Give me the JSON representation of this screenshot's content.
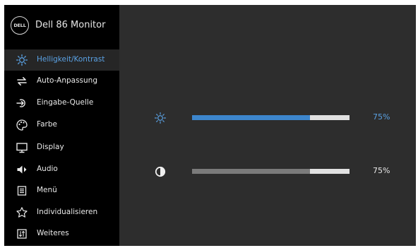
{
  "brand": {
    "logo_text": "DELL",
    "model": "Dell 86 Monitor"
  },
  "menu": [
    {
      "icon": "brightness-icon",
      "label": "Helligkeit/Kontrast",
      "active": true
    },
    {
      "icon": "auto-adjust-icon",
      "label": "Auto-Anpassung",
      "active": false
    },
    {
      "icon": "input-source-icon",
      "label": "Eingabe-Quelle",
      "active": false
    },
    {
      "icon": "palette-icon",
      "label": "Farbe",
      "active": false
    },
    {
      "icon": "display-icon",
      "label": "Display",
      "active": false
    },
    {
      "icon": "audio-icon",
      "label": "Audio",
      "active": false
    },
    {
      "icon": "menu-icon",
      "label": "Menü",
      "active": false
    },
    {
      "icon": "star-icon",
      "label": "Individualisieren",
      "active": false
    },
    {
      "icon": "others-icon",
      "label": "Weiteres",
      "active": false
    }
  ],
  "controls": {
    "brightness": {
      "icon": "brightness-icon",
      "value": 75,
      "display": "75%",
      "fill_color": "#3d86cc",
      "text_color": "#5aa1e3",
      "selected": true
    },
    "contrast": {
      "icon": "contrast-icon",
      "value": 75,
      "display": "75%",
      "fill_color": "#7b7b7b",
      "text_color": "#e8e8e8",
      "selected": false
    }
  },
  "colors": {
    "accent": "#5aa1e3",
    "sidebar_bg": "#000000",
    "panel_bg": "#2d2d2d"
  }
}
